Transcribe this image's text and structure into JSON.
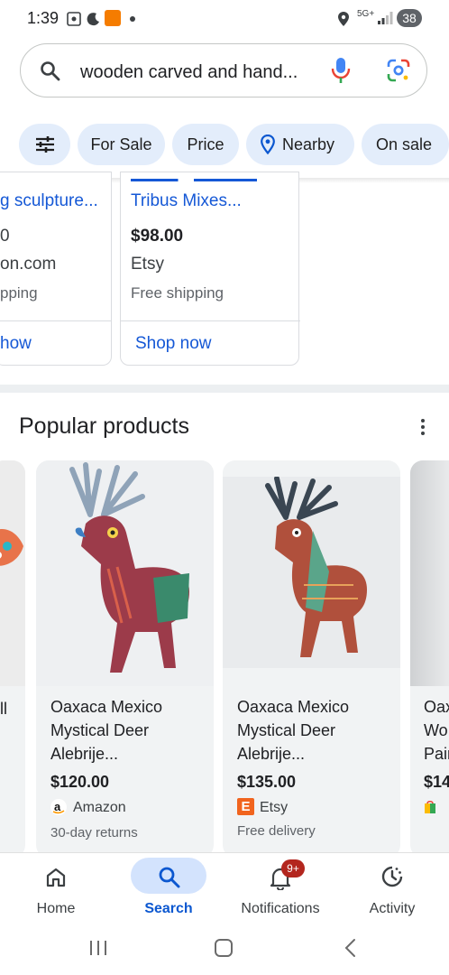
{
  "status": {
    "time": "1:39",
    "network": "5G+",
    "battery": "38"
  },
  "search": {
    "query": "wooden carved and hand..."
  },
  "chips": [
    {
      "label": ""
    },
    {
      "label": "For Sale"
    },
    {
      "label": "Price"
    },
    {
      "label": "Nearby"
    },
    {
      "label": "On sale"
    }
  ],
  "top_cards": [
    {
      "title": "g sculpture...",
      "price": "0",
      "merchant": "on.com",
      "shipping": "pping",
      "action": "how"
    },
    {
      "title": "Tribus Mixes...",
      "price": "$98.00",
      "merchant": "Etsy",
      "shipping": "Free shipping",
      "action": "Shop now"
    }
  ],
  "popular": {
    "title": "Popular products",
    "cards": [
      {
        "title_line1": "ll",
        "title_line2": "",
        "title_line3": "",
        "price": "",
        "merchant": "",
        "sub": ""
      },
      {
        "title_line1": "Oaxaca Mexico",
        "title_line2": "Mystical Deer",
        "title_line3": "Alebrije...",
        "price": "$120.00",
        "merchant": "Amazon",
        "sub": "30-day returns"
      },
      {
        "title_line1": "Oaxaca Mexico",
        "title_line2": "Mystical Deer",
        "title_line3": "Alebrije...",
        "price": "$135.00",
        "merchant": "Etsy",
        "sub": "Free delivery"
      },
      {
        "title_line1": "Oax",
        "title_line2": "Wo",
        "title_line3": "Pair",
        "price": "$14",
        "merchant": "",
        "sub": ""
      }
    ]
  },
  "nav": {
    "home": "Home",
    "search": "Search",
    "notifications": "Notifications",
    "notifications_badge": "9+",
    "activity": "Activity"
  },
  "colors": {
    "accent": "#0b57d0",
    "chip_bg": "#e3edfb",
    "link": "#1a0dab",
    "badge_red": "#b3261e"
  }
}
